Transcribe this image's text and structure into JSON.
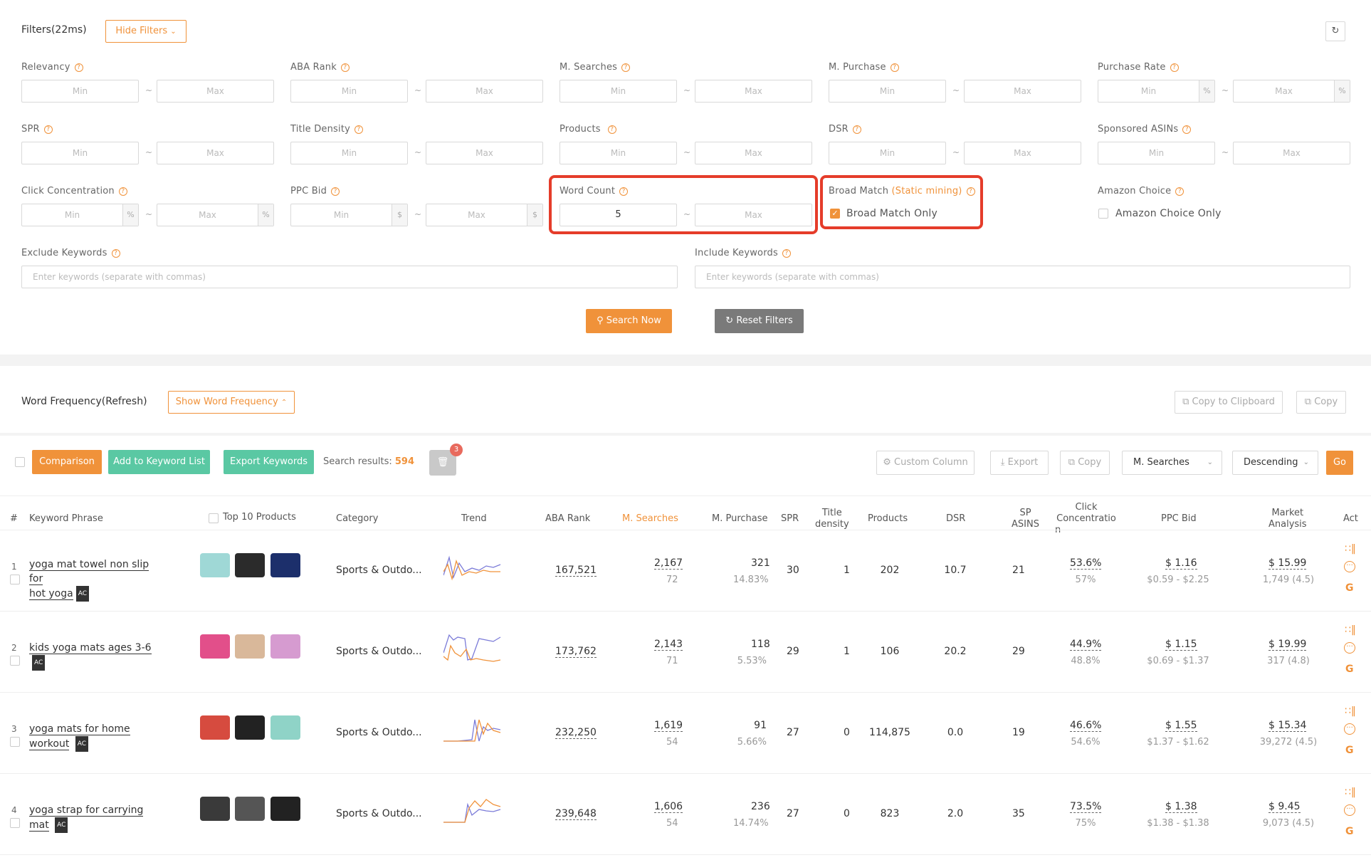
{
  "filters": {
    "title": "Filters(22ms)",
    "hide_button": "Hide Filters",
    "min": "Min",
    "max": "Max",
    "tilde": "~",
    "pct": "%",
    "dollar": "$",
    "fields": {
      "relevancy": "Relevancy",
      "aba_rank": "ABA Rank",
      "m_searches": "M. Searches",
      "m_purchase": "M. Purchase",
      "purchase_rate": "Purchase Rate",
      "spr": "SPR",
      "title_density": "Title Density",
      "products": "Products",
      "dsr": "DSR",
      "sponsored_asins": "Sponsored ASINs",
      "click_concentration": "Click Concentration",
      "ppc_bid": "PPC Bid",
      "word_count": "Word Count",
      "word_count_min_value": "5",
      "broad_match": "Broad Match",
      "broad_match_note": "(Static mining)",
      "broad_match_only": "Broad Match Only",
      "broad_match_checked": true,
      "amazon_choice": "Amazon Choice",
      "amazon_choice_only": "Amazon Choice Only",
      "amazon_choice_checked": false,
      "exclude_keywords": "Exclude Keywords",
      "include_keywords": "Include Keywords",
      "keywords_placeholder": "Enter keywords (separate with commas)"
    },
    "search_now": "Search Now",
    "reset_filters": "Reset Filters"
  },
  "word_frequency": {
    "title": "Word Frequency(Refresh)",
    "show_button": "Show Word Frequency",
    "copy_clipboard": "Copy to Clipboard",
    "copy": "Copy"
  },
  "toolbar": {
    "comparison": "Comparison",
    "add_to_list": "Add to Keyword List",
    "export_keywords": "Export Keywords",
    "search_results_label": "Search results:",
    "search_results_count": "594",
    "trash_badge": "3",
    "custom_column": "Custom Column",
    "export": "Export",
    "copy": "Copy",
    "sort_field": "M. Searches",
    "sort_order": "Descending",
    "go": "Go"
  },
  "table": {
    "headers": {
      "num": "#",
      "keyword": "Keyword Phrase",
      "top10": "Top 10 Products",
      "category": "Category",
      "trend": "Trend",
      "aba": "ABA Rank",
      "msearch": "M. Searches",
      "mpurchase": "M. Purchase",
      "spr": "SPR",
      "title_density_1": "Title",
      "title_density_2": "density",
      "products": "Products",
      "dsr": "DSR",
      "sp_1": "SP",
      "sp_2": "ASINS",
      "click_1": "Click",
      "click_2": "Concentratio",
      "click_3": "n",
      "ppc": "PPC Bid",
      "market_1": "Market",
      "market_2": "Analysis",
      "act": "Act"
    },
    "ac_badge": "AC",
    "rows": [
      {
        "num": "1",
        "kw1": "yoga mat towel non slip for",
        "kw2": "hot yoga",
        "category": "Sports & Outdo...",
        "aba": "167,521",
        "ms": "2,167",
        "ms_sub": "72",
        "mp": "321",
        "mp_sub": "14.83%",
        "spr": "30",
        "td": "1",
        "products": "202",
        "dsr": "10.7",
        "sp": "21",
        "cc": "53.6%",
        "cc_sub": "57%",
        "ppc": "$ 1.16",
        "ppc_sub": "$0.59 - $2.25",
        "ma": "$ 15.99",
        "ma_sub": "1,749 (4.5)"
      },
      {
        "num": "2",
        "kw1": "kids yoga mats ages 3-6",
        "kw2": "",
        "category": "Sports & Outdo...",
        "aba": "173,762",
        "ms": "2,143",
        "ms_sub": "71",
        "mp": "118",
        "mp_sub": "5.53%",
        "spr": "29",
        "td": "1",
        "products": "106",
        "dsr": "20.2",
        "sp": "29",
        "cc": "44.9%",
        "cc_sub": "48.8%",
        "ppc": "$ 1.15",
        "ppc_sub": "$0.69 - $1.37",
        "ma": "$ 19.99",
        "ma_sub": "317 (4.8)"
      },
      {
        "num": "3",
        "kw1": "yoga mats for home workout",
        "kw2": "",
        "category": "Sports & Outdo...",
        "aba": "232,250",
        "ms": "1,619",
        "ms_sub": "54",
        "mp": "91",
        "mp_sub": "5.66%",
        "spr": "27",
        "td": "0",
        "products": "114,875",
        "dsr": "0.0",
        "sp": "19",
        "cc": "46.6%",
        "cc_sub": "54.6%",
        "ppc": "$ 1.55",
        "ppc_sub": "$1.37 - $1.62",
        "ma": "$ 15.34",
        "ma_sub": "39,272 (4.5)"
      },
      {
        "num": "4",
        "kw1": "yoga strap for carrying mat",
        "kw2": "",
        "category": "Sports & Outdo...",
        "aba": "239,648",
        "ms": "1,606",
        "ms_sub": "54",
        "mp": "236",
        "mp_sub": "14.74%",
        "spr": "27",
        "td": "0",
        "products": "823",
        "dsr": "2.0",
        "sp": "35",
        "cc": "73.5%",
        "cc_sub": "75%",
        "ppc": "$ 1.38",
        "ppc_sub": "$1.38 - $1.38",
        "ma": "$ 9.45",
        "ma_sub": "9,073 (4.5)"
      }
    ]
  },
  "colors": {
    "accent": "#f0923a",
    "green": "#5ac8a3",
    "highlight": "#e53c2a"
  }
}
